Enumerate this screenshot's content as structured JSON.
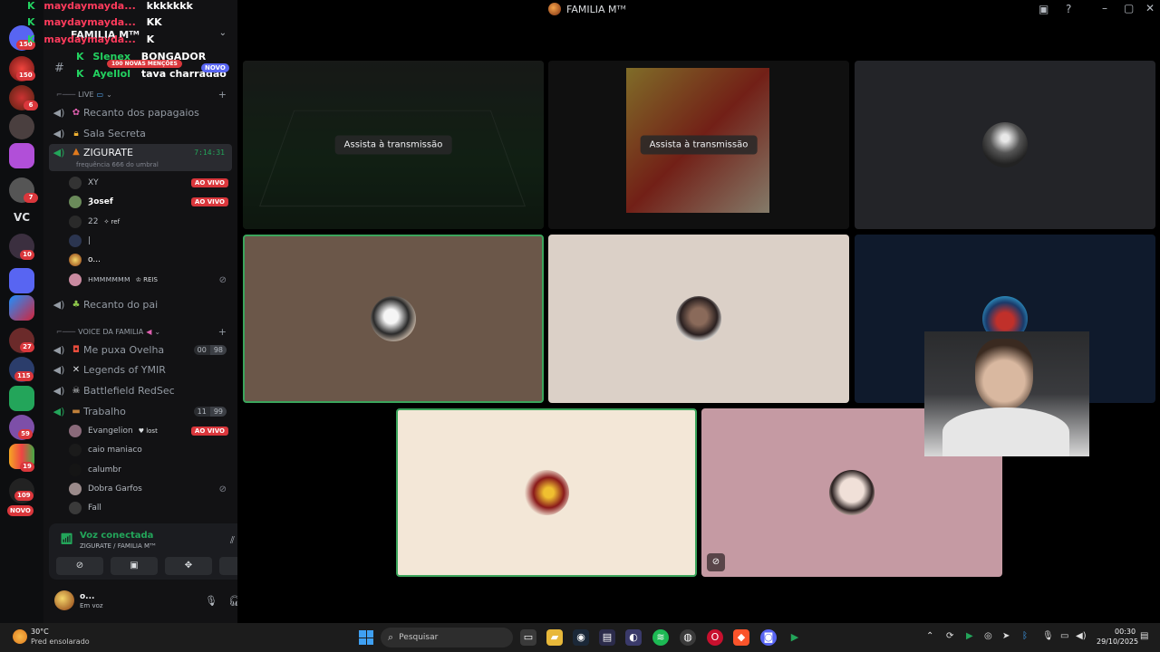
{
  "window": {
    "title": "FAMILIA Mᵀᴹ"
  },
  "overlay_chat": [
    {
      "name": "maydaymayda...",
      "text": "kkkkkkk"
    },
    {
      "name": "maydaymayda...",
      "text": "KK"
    },
    {
      "name": "maydaymayda...",
      "text": "K"
    },
    {
      "name": "Slenex",
      "text": "BONGADOR"
    },
    {
      "name": "Ayellol",
      "text": "tava charradao"
    }
  ],
  "server": {
    "name": "FAMILIA Mᵀᴹ"
  },
  "notices": {
    "new_mentions": "100 NOVAS MENÇÕES",
    "novo": "NOVO"
  },
  "rail": {
    "badges": [
      "150",
      "6",
      "7",
      "10",
      "27",
      "115",
      "59",
      "19",
      "109"
    ],
    "vc_label": "VC",
    "novo": "NOVO"
  },
  "categories": {
    "live": "LIVE",
    "voice": "VOICE DA FAMILIA"
  },
  "channels": {
    "recanto": "Recanto dos papagaios",
    "sala": "Sala Secreta",
    "zigurate": "ZIGURATE",
    "zigurate_sub": "frequência 666 do umbral",
    "zigurate_time": "7:14:31",
    "recanto_pai": "Recanto do pai",
    "me_puxa": "Me puxa Ovelha",
    "me_puxa_count": [
      "00",
      "98"
    ],
    "legends": "Legends of YMIR",
    "battlefield": "Battlefield RedSec",
    "trabalho": "Trabalho",
    "trabalho_count": [
      "11",
      "99"
    ]
  },
  "zig_users": [
    {
      "name": "XY",
      "tag": "",
      "live": "AO VIVO"
    },
    {
      "name": "Ȝosef",
      "tag": "",
      "live": "AO VIVO"
    },
    {
      "name": "22",
      "tag": "✧ ref",
      "live": ""
    },
    {
      "name": "|",
      "tag": "",
      "live": ""
    },
    {
      "name": "o...",
      "tag": "",
      "live": ""
    },
    {
      "name": "ʜᴍᴍᴍᴍᴍᴍ",
      "tag": "♔ REIS",
      "live": ""
    }
  ],
  "trab_users": [
    {
      "name": "Evangelion",
      "tag": "♥ lost",
      "live": "AO VIVO"
    },
    {
      "name": "caio maniaco",
      "tag": "",
      "live": ""
    },
    {
      "name": "calumbr",
      "tag": "",
      "live": ""
    },
    {
      "name": "Dobra Garfos",
      "tag": "",
      "live": ""
    },
    {
      "name": "Fall",
      "tag": "",
      "live": ""
    }
  ],
  "voice_panel": {
    "title": "Voz conectada",
    "subtitle": "ZIGURATE / FAMILIA Mᵀᴹ"
  },
  "user": {
    "name": "o...",
    "status": "Em voz"
  },
  "stage": {
    "watch_label": "Assista à transmissão"
  },
  "taskbar": {
    "weather_temp": "30°C",
    "weather_desc": "Pred ensolarado",
    "search_placeholder": "Pesquisar",
    "time": "00:30",
    "date": "29/10/2025"
  },
  "colors": {
    "accent": "#5865f2",
    "live_red": "#da373c",
    "online_green": "#23a55a"
  }
}
